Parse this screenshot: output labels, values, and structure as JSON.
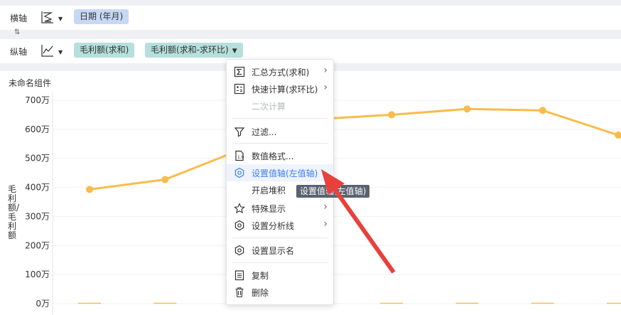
{
  "x_axis": {
    "label": "横轴",
    "field": "日期 (年月)"
  },
  "y_axis": {
    "label": "纵轴",
    "fields": [
      "毛利额(求和)",
      "毛利额(求和-求环比)"
    ]
  },
  "swap_symbol": "⇅",
  "widget": {
    "title": "未命名组件",
    "y_axis_title": "毛利额/毛利额"
  },
  "chart_data": {
    "type": "line",
    "y_ticks": [
      "700万",
      "600万",
      "500万",
      "400万",
      "300万",
      "200万",
      "100万",
      "0万"
    ],
    "ylim": [
      0,
      700
    ],
    "y_unit": "万",
    "line_color": "#f8bc4a",
    "series": [
      {
        "values": [
          393,
          427,
          530,
          635,
          650,
          670,
          665,
          580
        ]
      }
    ],
    "bar_values": [
      0.5,
      0.5,
      0.5,
      0.5,
      0.5,
      0.5,
      0.5,
      0.5
    ]
  },
  "context_menu": {
    "items": [
      {
        "label": "汇总方式(求和)",
        "icon": "sigma-icon",
        "submenu": true
      },
      {
        "label": "快速计算(求环比)",
        "icon": "grid-calc-icon",
        "submenu": true
      },
      {
        "label": "二次计算",
        "icon": "",
        "disabled": true
      },
      {
        "label": "过滤...",
        "icon": "filter-icon"
      },
      {
        "label": "数值格式...",
        "icon": "number-format-icon"
      },
      {
        "label": "设置值轴(左值轴)",
        "icon": "gear-icon",
        "active": true
      },
      {
        "label": "开启堆积",
        "icon": ""
      },
      {
        "label": "特殊显示",
        "icon": "star-icon",
        "submenu": true
      },
      {
        "label": "设置分析线",
        "icon": "gear-icon",
        "submenu": true
      },
      {
        "label": "设置显示名",
        "icon": "gear-icon"
      },
      {
        "label": "复制",
        "icon": "copy-icon"
      },
      {
        "label": "删除",
        "icon": "trash-icon"
      }
    ]
  },
  "tooltip": {
    "text": "设置值轴(左值轴)"
  },
  "colors": {
    "accent": "#3d7ef5",
    "annotation_arrow": "#e8413c"
  }
}
